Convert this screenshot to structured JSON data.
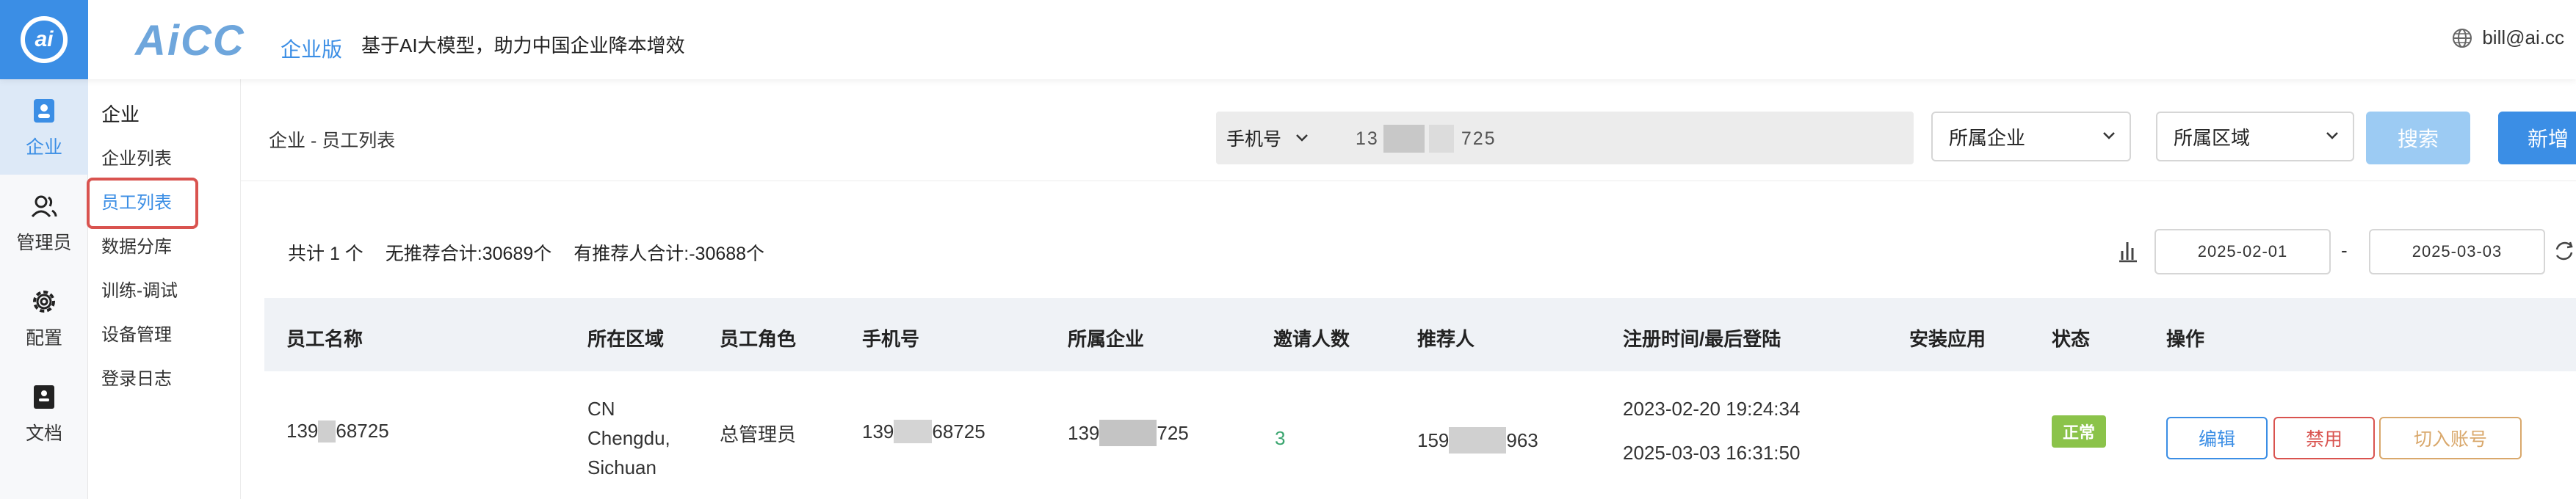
{
  "header": {
    "brand": "AiCC",
    "edition": "企业版",
    "slogan": "基于AI大模型，助力中国企业降本增效",
    "user": "bill@ai.cc",
    "globe_icon": "globe-icon"
  },
  "nav": {
    "items": [
      {
        "label": "企业",
        "icon": "enterprise-icon",
        "active": true
      },
      {
        "label": "管理员",
        "icon": "admin-icon",
        "active": false
      },
      {
        "label": "配置",
        "icon": "gear-icon",
        "active": false
      },
      {
        "label": "文档",
        "icon": "document-icon",
        "active": false
      }
    ]
  },
  "submenu": {
    "title": "企业",
    "items": [
      "企业列表",
      "员工列表",
      "数据分库",
      "训练-调试",
      "设备管理",
      "登录日志"
    ],
    "active_index": 1
  },
  "breadcrumb": "企业 - 员工列表",
  "search": {
    "field_select": "手机号",
    "phone_prefix": "13",
    "phone_suffix": "725",
    "company_select": "所属企业",
    "region_select": "所属区域",
    "search_label": "搜索",
    "add_label": "新增"
  },
  "summary": {
    "total": "共计 1 个",
    "no_referrer": "无推荐合计:30689个",
    "with_referrer": "有推荐人合计:-30688个"
  },
  "date_range": {
    "start": "2025-02-01",
    "separator": "-",
    "end": "2025-03-03"
  },
  "table": {
    "headers": [
      "员工名称",
      "所在区域",
      "员工角色",
      "手机号",
      "所属企业",
      "邀请人数",
      "推荐人",
      "注册时间/最后登陆",
      "安装应用",
      "状态",
      "操作"
    ],
    "row": {
      "name_prefix": "139",
      "name_suffix": "68725",
      "region_line1": "CN",
      "region_line2": "Chengdu,",
      "region_line3": "Sichuan",
      "role": "总管理员",
      "phone_prefix": "139",
      "phone_suffix": "68725",
      "company_prefix": "139",
      "company_suffix": "725",
      "invites": "3",
      "referrer_prefix": "159",
      "referrer_suffix": "963",
      "registered": "2023-02-20 19:24:34",
      "last_login": "2025-03-03 16:31:50",
      "status": "正常",
      "actions": [
        "编辑",
        "禁用",
        "切入账号"
      ]
    }
  },
  "colors": {
    "primary": "#3b8ee5",
    "search_btn": "#9ccbf3",
    "status_ok": "#8bc34a",
    "danger": "#d9534f",
    "warning": "#d9a86c"
  }
}
